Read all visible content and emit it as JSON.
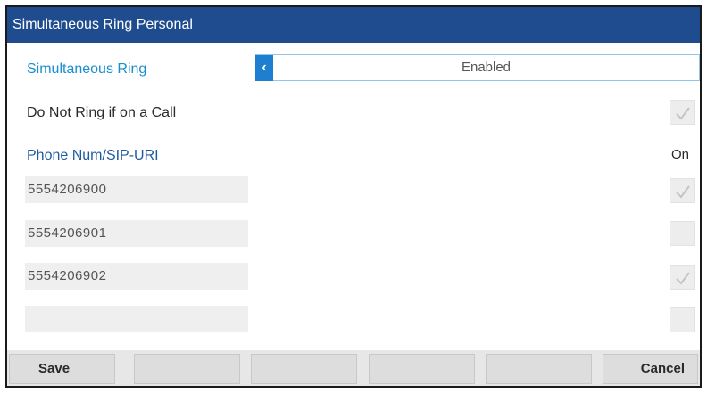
{
  "title": "Simultaneous Ring Personal",
  "simultaneous_ring": {
    "label": "Simultaneous Ring",
    "value": "Enabled",
    "arrow_icon": "chevron-left-icon"
  },
  "do_not_ring": {
    "label": "Do Not Ring if on a Call",
    "checked": true
  },
  "list_header": {
    "left": "Phone Num/SIP-URI",
    "right": "On"
  },
  "numbers": [
    {
      "value": "5554206900",
      "on": true
    },
    {
      "value": "5554206901",
      "on": false
    },
    {
      "value": "5554206902",
      "on": true
    },
    {
      "value": "",
      "on": false
    }
  ],
  "softkeys": [
    "Save",
    "",
    "",
    "",
    "",
    "Cancel"
  ],
  "colors": {
    "titlebar": "#1e4c8f",
    "accent": "#1a8ed0",
    "arrow": "#1e7fd0"
  }
}
